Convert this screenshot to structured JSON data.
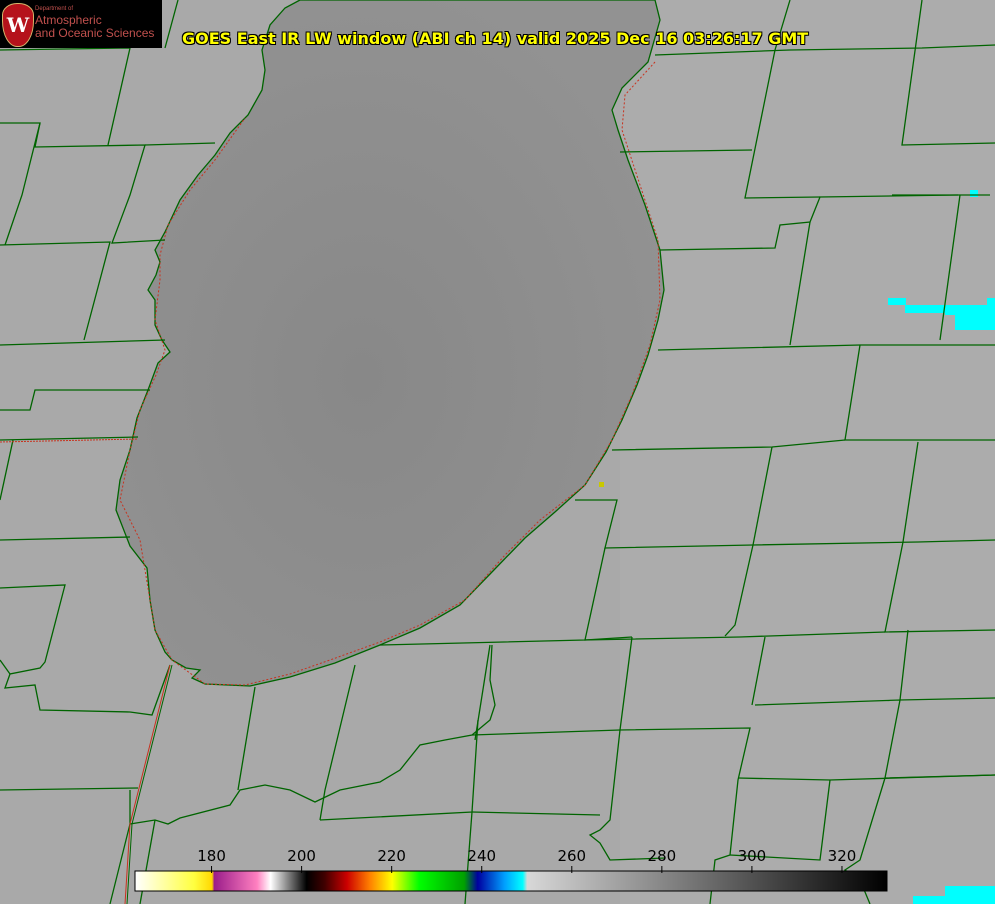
{
  "logo": {
    "department": "Department of",
    "line1": "Atmospheric",
    "line2": "and Oceanic Sciences",
    "seal_letter": "W"
  },
  "title": "GOES East IR LW window (ABI ch 14) valid 2025 Dec 16 03:26:17 GMT",
  "colorbar": {
    "unit_ticks": [
      "180",
      "200",
      "220",
      "240",
      "260",
      "280",
      "300",
      "320"
    ],
    "tick_values": [
      180,
      200,
      220,
      240,
      260,
      280,
      300,
      320
    ],
    "range": [
      163,
      330
    ],
    "stops": [
      {
        "v": 163,
        "c": "#ffffff"
      },
      {
        "v": 176,
        "c": "#ffff40"
      },
      {
        "v": 180,
        "c": "#ffd700"
      },
      {
        "v": 180.5,
        "c": "#9b1d8a"
      },
      {
        "v": 190,
        "c": "#ff80c0"
      },
      {
        "v": 193,
        "c": "#ffffff"
      },
      {
        "v": 201,
        "c": "#000000"
      },
      {
        "v": 205,
        "c": "#400000"
      },
      {
        "v": 210,
        "c": "#cc0000"
      },
      {
        "v": 215,
        "c": "#ff7f00"
      },
      {
        "v": 220,
        "c": "#ffff00"
      },
      {
        "v": 226,
        "c": "#00ff00"
      },
      {
        "v": 236,
        "c": "#00a000"
      },
      {
        "v": 239,
        "c": "#0000a0"
      },
      {
        "v": 245,
        "c": "#00a0ff"
      },
      {
        "v": 249,
        "c": "#00ffff"
      },
      {
        "v": 250,
        "c": "#d8d8d8"
      },
      {
        "v": 330,
        "c": "#000000"
      }
    ]
  },
  "colors": {
    "background": "#a9a9a9",
    "lake": "#8e8e8e",
    "county_border": "#006400",
    "state_border": "#c8321e",
    "cold_cloud": "#00ffff",
    "title": "#ffff00"
  },
  "map": {
    "feature": "lake",
    "marker_color": "#c8c800"
  }
}
